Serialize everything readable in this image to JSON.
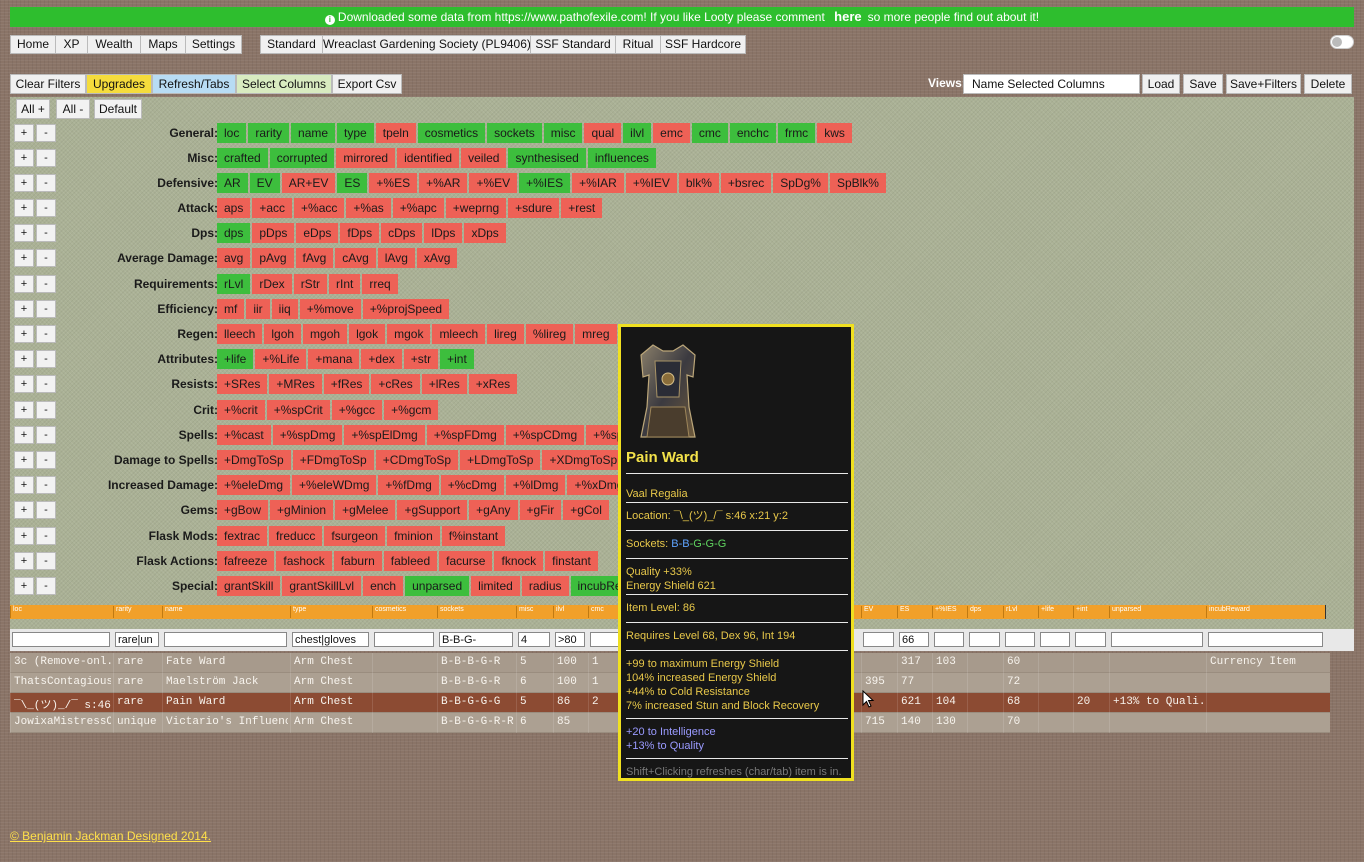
{
  "banner": {
    "text_before": "Downloaded some data from https://www.pathofexile.com! If you like Looty please comment",
    "link": "here",
    "text_after": "so more people find out about it!"
  },
  "nav": {
    "main": [
      "Home",
      "XP",
      "Wealth",
      "Maps",
      "Settings"
    ],
    "leagues": [
      "Standard",
      "Wreaclast Gardening Society (PL9406)",
      "SSF Standard",
      "Ritual",
      "SSF Hardcore"
    ]
  },
  "toolbar": {
    "clear_filters": "Clear Filters",
    "upgrades": "Upgrades",
    "refresh_tabs": "Refresh/Tabs",
    "select_columns": "Select Columns",
    "export_csv": "Export Csv",
    "views_label": "Views:",
    "views_value": "Name Selected Columns",
    "load": "Load",
    "save": "Save",
    "save_filters": "Save+Filters",
    "delete": "Delete"
  },
  "panel": {
    "all_plus": "All +",
    "all_minus": "All -",
    "default": "Default",
    "plus": "+",
    "minus": "-"
  },
  "groups": [
    {
      "label": "General:",
      "chips": [
        [
          "loc",
          "g"
        ],
        [
          "rarity",
          "g"
        ],
        [
          "name",
          "g"
        ],
        [
          "type",
          "g"
        ],
        [
          "tpeln",
          "r"
        ],
        [
          "cosmetics",
          "g"
        ],
        [
          "sockets",
          "g"
        ],
        [
          "misc",
          "g"
        ],
        [
          "qual",
          "r"
        ],
        [
          "ilvl",
          "g"
        ],
        [
          "emc",
          "r"
        ],
        [
          "cmc",
          "g"
        ],
        [
          "enchc",
          "g"
        ],
        [
          "frmc",
          "g"
        ],
        [
          "kws",
          "r"
        ]
      ]
    },
    {
      "label": "Misc:",
      "chips": [
        [
          "crafted",
          "g"
        ],
        [
          "corrupted",
          "g"
        ],
        [
          "mirrored",
          "r"
        ],
        [
          "identified",
          "r"
        ],
        [
          "veiled",
          "r"
        ],
        [
          "synthesised",
          "g"
        ],
        [
          "influences",
          "g"
        ]
      ]
    },
    {
      "label": "Defensive:",
      "chips": [
        [
          "AR",
          "g"
        ],
        [
          "EV",
          "g"
        ],
        [
          "AR+EV",
          "r"
        ],
        [
          "ES",
          "g"
        ],
        [
          "+%ES",
          "r"
        ],
        [
          "+%AR",
          "r"
        ],
        [
          "+%EV",
          "r"
        ],
        [
          "+%IES",
          "g"
        ],
        [
          "+%IAR",
          "r"
        ],
        [
          "+%IEV",
          "r"
        ],
        [
          "blk%",
          "r"
        ],
        [
          "+bsrec",
          "r"
        ],
        [
          "SpDg%",
          "r"
        ],
        [
          "SpBlk%",
          "r"
        ]
      ]
    },
    {
      "label": "Attack:",
      "chips": [
        [
          "aps",
          "r"
        ],
        [
          "+acc",
          "r"
        ],
        [
          "+%acc",
          "r"
        ],
        [
          "+%as",
          "r"
        ],
        [
          "+%apc",
          "r"
        ],
        [
          "+weprng",
          "r"
        ],
        [
          "+sdure",
          "r"
        ],
        [
          "+rest",
          "r"
        ]
      ]
    },
    {
      "label": "Dps:",
      "chips": [
        [
          "dps",
          "g"
        ],
        [
          "pDps",
          "r"
        ],
        [
          "eDps",
          "r"
        ],
        [
          "fDps",
          "r"
        ],
        [
          "cDps",
          "r"
        ],
        [
          "lDps",
          "r"
        ],
        [
          "xDps",
          "r"
        ]
      ]
    },
    {
      "label": "Average Damage:",
      "chips": [
        [
          "avg",
          "r"
        ],
        [
          "pAvg",
          "r"
        ],
        [
          "fAvg",
          "r"
        ],
        [
          "cAvg",
          "r"
        ],
        [
          "lAvg",
          "r"
        ],
        [
          "xAvg",
          "r"
        ]
      ]
    },
    {
      "label": "Requirements:",
      "chips": [
        [
          "rLvl",
          "g"
        ],
        [
          "rDex",
          "r"
        ],
        [
          "rStr",
          "r"
        ],
        [
          "rInt",
          "r"
        ],
        [
          "rreq",
          "r"
        ]
      ]
    },
    {
      "label": "Efficiency:",
      "chips": [
        [
          "mf",
          "r"
        ],
        [
          "iir",
          "r"
        ],
        [
          "iiq",
          "r"
        ],
        [
          "+%move",
          "r"
        ],
        [
          "+%projSpeed",
          "r"
        ]
      ]
    },
    {
      "label": "Regen:",
      "chips": [
        [
          "lleech",
          "r"
        ],
        [
          "lgoh",
          "r"
        ],
        [
          "mgoh",
          "r"
        ],
        [
          "lgok",
          "r"
        ],
        [
          "mgok",
          "r"
        ],
        [
          "mleech",
          "r"
        ],
        [
          "lireg",
          "r"
        ],
        [
          "%lireg",
          "r"
        ],
        [
          "mreg",
          "r"
        ]
      ]
    },
    {
      "label": "Attributes:",
      "chips": [
        [
          "+life",
          "g"
        ],
        [
          "+%Life",
          "r"
        ],
        [
          "+mana",
          "r"
        ],
        [
          "+dex",
          "r"
        ],
        [
          "+str",
          "r"
        ],
        [
          "+int",
          "g"
        ]
      ]
    },
    {
      "label": "Resists:",
      "chips": [
        [
          "+SRes",
          "r"
        ],
        [
          "+MRes",
          "r"
        ],
        [
          "+fRes",
          "r"
        ],
        [
          "+cRes",
          "r"
        ],
        [
          "+lRes",
          "r"
        ],
        [
          "+xRes",
          "r"
        ]
      ]
    },
    {
      "label": "Crit:",
      "chips": [
        [
          "+%crit",
          "r"
        ],
        [
          "+%spCrit",
          "r"
        ],
        [
          "+%gcc",
          "r"
        ],
        [
          "+%gcm",
          "r"
        ]
      ]
    },
    {
      "label": "Spells:",
      "chips": [
        [
          "+%cast",
          "r"
        ],
        [
          "+%spDmg",
          "r"
        ],
        [
          "+%spElDmg",
          "r"
        ],
        [
          "+%spFDmg",
          "r"
        ],
        [
          "+%spCDmg",
          "r"
        ],
        [
          "+%spLDmg",
          "r"
        ]
      ]
    },
    {
      "label": "Damage to Spells:",
      "chips": [
        [
          "+DmgToSp",
          "r"
        ],
        [
          "+FDmgToSp",
          "r"
        ],
        [
          "+CDmgToSp",
          "r"
        ],
        [
          "+LDmgToSp",
          "r"
        ],
        [
          "+XDmgToSp",
          "r"
        ]
      ]
    },
    {
      "label": "Increased Damage:",
      "chips": [
        [
          "+%eleDmg",
          "r"
        ],
        [
          "+%eleWDmg",
          "r"
        ],
        [
          "+%fDmg",
          "r"
        ],
        [
          "+%cDmg",
          "r"
        ],
        [
          "+%lDmg",
          "r"
        ],
        [
          "+%xDmg",
          "r"
        ]
      ]
    },
    {
      "label": "Gems:",
      "chips": [
        [
          "+gBow",
          "r"
        ],
        [
          "+gMinion",
          "r"
        ],
        [
          "+gMelee",
          "r"
        ],
        [
          "+gSupport",
          "r"
        ],
        [
          "+gAny",
          "r"
        ],
        [
          "+gFir",
          "r"
        ],
        [
          "+gCol",
          "r"
        ]
      ]
    },
    {
      "label": "Flask Mods:",
      "chips": [
        [
          "fextrac",
          "r"
        ],
        [
          "freducc",
          "r"
        ],
        [
          "fsurgeon",
          "r"
        ],
        [
          "fminion",
          "r"
        ],
        [
          "f%instant",
          "r"
        ]
      ]
    },
    {
      "label": "Flask Actions:",
      "chips": [
        [
          "fafreeze",
          "r"
        ],
        [
          "fashock",
          "r"
        ],
        [
          "faburn",
          "r"
        ],
        [
          "fableed",
          "r"
        ],
        [
          "facurse",
          "r"
        ],
        [
          "fknock",
          "r"
        ],
        [
          "finstant",
          "r"
        ]
      ]
    },
    {
      "label": "Special:",
      "chips": [
        [
          "grantSkill",
          "r"
        ],
        [
          "grantSkillLvl",
          "r"
        ],
        [
          "ench",
          "r"
        ],
        [
          "unparsed",
          "g"
        ],
        [
          "limited",
          "r"
        ],
        [
          "radius",
          "r"
        ],
        [
          "incubRev",
          "g"
        ]
      ]
    }
  ],
  "table": {
    "headers": [
      "loc",
      "rarity",
      "name",
      "type",
      "cosmetics",
      "sockets",
      "misc",
      "ilvl",
      "cmc",
      "EV",
      "ES",
      "+%IES",
      "dps",
      "rLvl",
      "+life",
      "+int",
      "unparsed",
      "incubReward"
    ],
    "filters": [
      "",
      "rare|un",
      "",
      "chest|gloves",
      "",
      "B-B-G-",
      "4",
      ">80",
      "",
      "",
      "66",
      "",
      "",
      "",
      "",
      "",
      "",
      ""
    ],
    "rows": [
      [
        "3c (Remove-onl...",
        "rare",
        "Fate Ward",
        "Arm Chest",
        "",
        "B-B-B-G-R",
        "5",
        "100",
        "1",
        "",
        "317",
        "103",
        "",
        "60",
        "",
        "",
        "",
        "Currency Item"
      ],
      [
        "ThatsContagious...",
        "rare",
        "Maelström Jack",
        "Arm Chest",
        "",
        "B-B-B-G-R",
        "6",
        "100",
        "1",
        "395",
        "77",
        "",
        "",
        "72",
        "",
        "",
        "",
        ""
      ],
      [
        "¯\\_(ツ)_/¯ s:46 ...",
        "rare",
        "Pain Ward",
        "Arm Chest",
        "",
        "B-B-G-G-G",
        "5",
        "86",
        "2",
        "",
        "621",
        "104",
        "",
        "68",
        "",
        "20",
        "+13% to Quali...",
        ""
      ],
      [
        "JowixaMistressO...",
        "unique",
        "Victario's Influence",
        "Arm Chest",
        "",
        "B-B-G-G-R-R",
        "6",
        "85",
        "",
        "715",
        "140",
        "130",
        "",
        "70",
        "",
        "",
        "",
        ""
      ]
    ]
  },
  "tooltip": {
    "name": "Pain Ward",
    "base": "Vaal Regalia",
    "location": "Location: ¯\\_(ツ)_/¯ s:46 x:21 y:2",
    "sockets_label": "Sockets:",
    "sockets": [
      "B",
      "B",
      "G",
      "G",
      "G"
    ],
    "quality": "Quality +33%",
    "energy_shield": "Energy Shield 621",
    "item_level": "Item Level: 86",
    "requires": "Requires Level 68, Dex 96, Int 194",
    "explicit": [
      "+99 to maximum Energy Shield",
      "104% increased Energy Shield",
      "+44% to Cold Resistance",
      "7% increased Stun and Block Recovery"
    ],
    "crafted": [
      "+20 to Intelligence",
      "+13% to Quality"
    ],
    "hint": "Shift+Clicking refreshes (char/tab) item is in."
  },
  "footer": "© Benjamin Jackman Designed 2014."
}
